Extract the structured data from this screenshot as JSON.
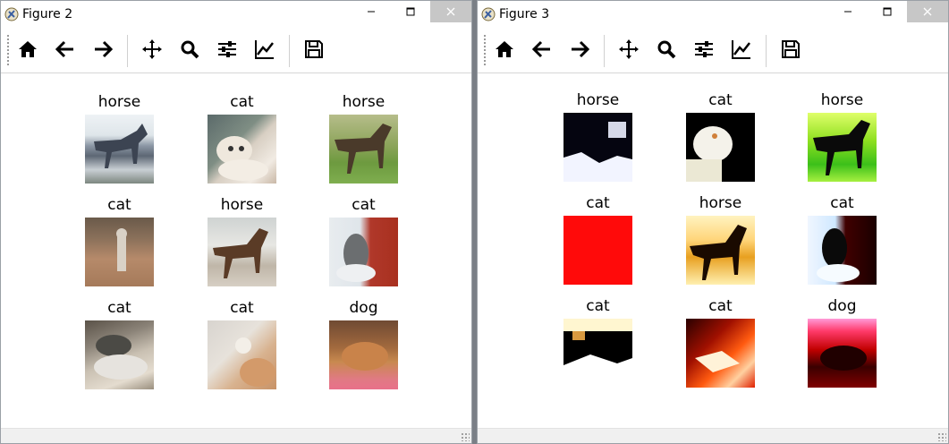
{
  "windows": [
    {
      "title": "Figure 2",
      "panels": [
        {
          "label": "horse"
        },
        {
          "label": "cat"
        },
        {
          "label": "horse"
        },
        {
          "label": "cat"
        },
        {
          "label": "horse"
        },
        {
          "label": "cat"
        },
        {
          "label": "cat"
        },
        {
          "label": "cat"
        },
        {
          "label": "dog"
        }
      ]
    },
    {
      "title": "Figure 3",
      "panels": [
        {
          "label": "horse"
        },
        {
          "label": "cat"
        },
        {
          "label": "horse"
        },
        {
          "label": "cat"
        },
        {
          "label": "horse"
        },
        {
          "label": "cat"
        },
        {
          "label": "cat"
        },
        {
          "label": "cat"
        },
        {
          "label": "dog"
        }
      ]
    }
  ],
  "toolbar_icons": [
    "home-icon",
    "back-arrow-icon",
    "forward-arrow-icon",
    "pan-icon",
    "zoom-icon",
    "configure-subplots-icon",
    "edit-axis-icon",
    "save-icon"
  ]
}
